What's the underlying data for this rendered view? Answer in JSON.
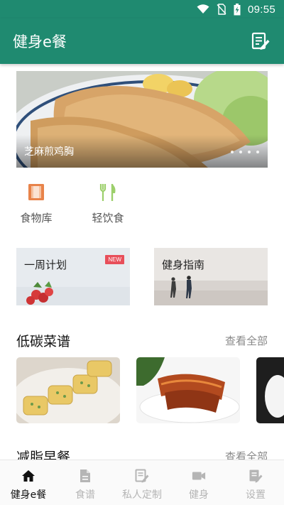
{
  "status_bar": {
    "time": "09:55",
    "icons": [
      "wifi-icon",
      "no-sim-icon",
      "battery-charging-icon"
    ]
  },
  "app_bar": {
    "title": "健身e餐",
    "action_icon": "edit-note-icon"
  },
  "banner": {
    "caption": "芝麻煎鸡胸",
    "slide_count": 4,
    "active_slide": 1
  },
  "quick_links": [
    {
      "label": "食物库",
      "icon": "book-icon",
      "color": "#e8834a"
    },
    {
      "label": "轻饮食",
      "icon": "fork-leaf-icon",
      "color": "#9ccf6b"
    }
  ],
  "plan_cards": [
    {
      "label": "一周计划",
      "badge": "NEW"
    },
    {
      "label": "健身指南"
    }
  ],
  "sections": {
    "low_carb": {
      "title": "低碳菜谱",
      "more": "查看全部"
    },
    "breakfast": {
      "title": "减脂早餐",
      "more": "查看全部"
    }
  },
  "tabs": [
    {
      "label": "健身e餐",
      "icon": "home-icon",
      "active": true
    },
    {
      "label": "食谱",
      "icon": "document-icon",
      "active": false
    },
    {
      "label": "私人定制",
      "icon": "edit-note-icon",
      "active": false
    },
    {
      "label": "健身",
      "icon": "video-camera-icon",
      "active": false
    },
    {
      "label": "设置",
      "icon": "settings-edit-icon",
      "active": false
    }
  ],
  "colors": {
    "primary": "#1f8a70",
    "accent_orange": "#e8834a",
    "accent_green": "#9ccf6b",
    "badge_red": "#e84f5a"
  }
}
